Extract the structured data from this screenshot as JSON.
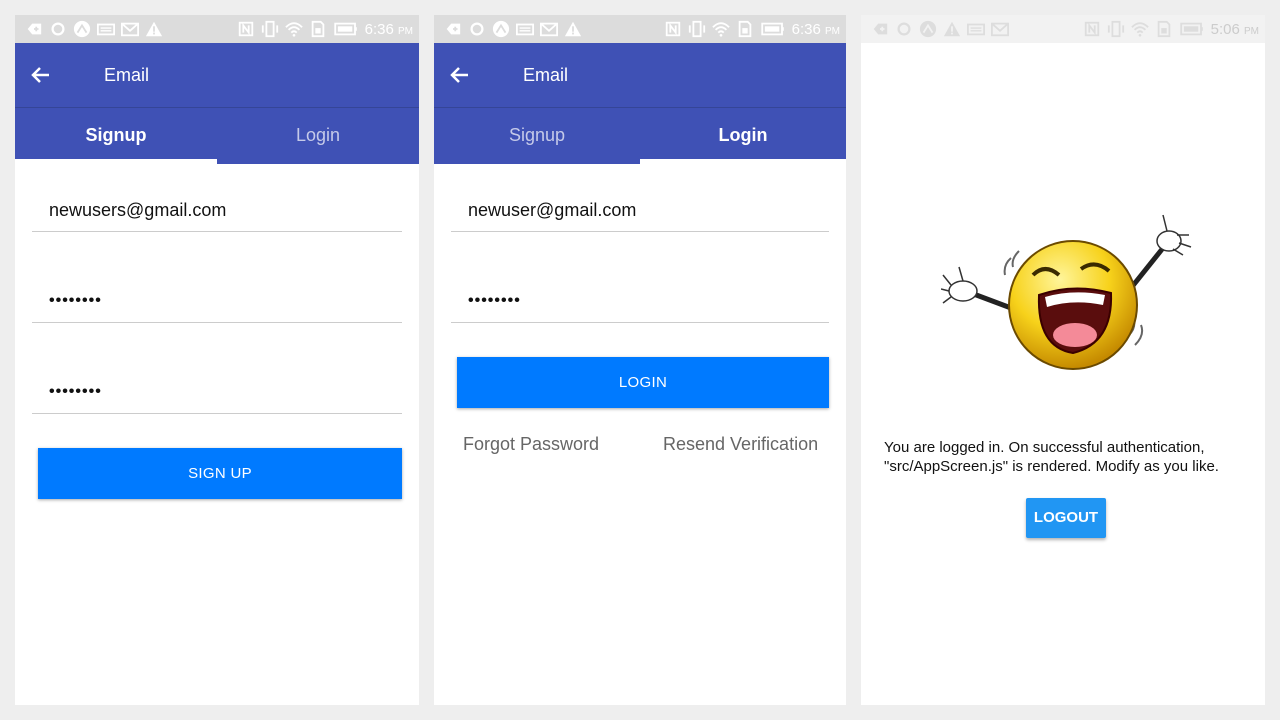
{
  "status_bar": {
    "time_left": "6:36",
    "time_middle": "6:36",
    "time_right": "5:06",
    "ampm": "PM",
    "icons": [
      "add-icon",
      "sync-icon",
      "expo-icon",
      "keyboard-icon",
      "mail-icon",
      "warning-icon",
      "nfc-icon",
      "vibrate-icon",
      "wifi-icon",
      "sim-icon",
      "battery-icon"
    ]
  },
  "signup_screen": {
    "title": "Email",
    "tabs": [
      {
        "label": "Signup",
        "active": true
      },
      {
        "label": "Login",
        "active": false
      }
    ],
    "email_value": "newusers@gmail.com",
    "password_value": "••••••••",
    "confirm_password_value": "••••••••",
    "submit_label": "SIGN UP"
  },
  "login_screen": {
    "title": "Email",
    "tabs": [
      {
        "label": "Signup",
        "active": false
      },
      {
        "label": "Login",
        "active": true
      }
    ],
    "email_value": "newuser@gmail.com",
    "password_value": "••••••••",
    "submit_label": "LOGIN",
    "forgot_password_label": "Forgot Password",
    "resend_verification_label": "Resend Verification"
  },
  "logged_in_screen": {
    "message": "You are logged in. On successful authentication, \"src/AppScreen.js\" is rendered. Modify as you like.",
    "logout_label": "LOGOUT"
  },
  "colors": {
    "app_bar": "#3f51b5",
    "primary_button": "#007aff",
    "logout_button": "#2196f3",
    "background": "#eeeeee"
  }
}
